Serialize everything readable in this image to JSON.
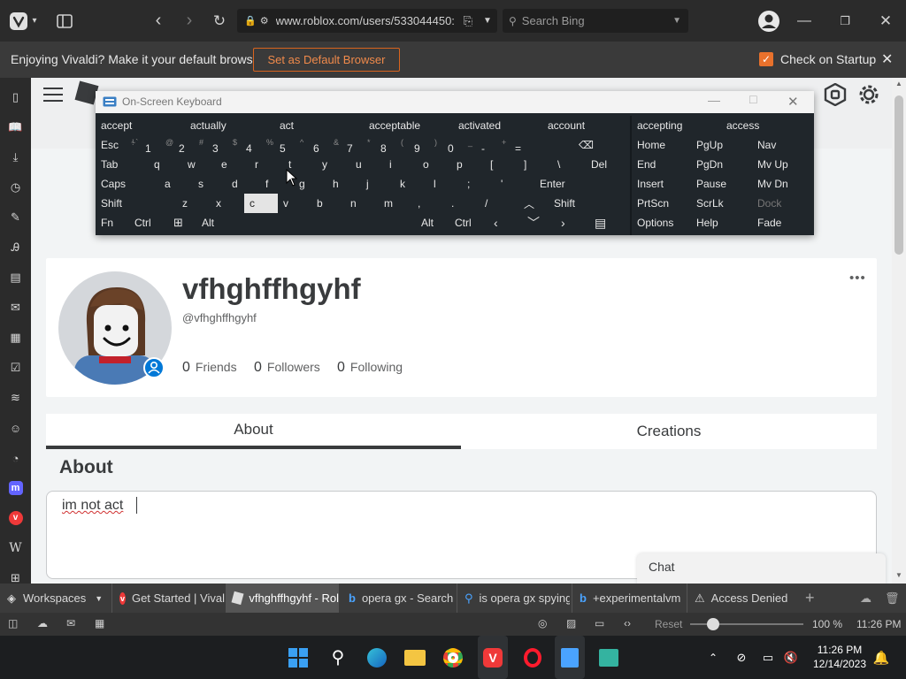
{
  "browser": {
    "url": "www.roblox.com/users/533044450:",
    "search_placeholder": "Search Bing",
    "notification_text": "Enjoying Vivaldi? Make it your default browser.",
    "default_button": "Set as Default Browser",
    "check_startup": "Check on Startup"
  },
  "osk": {
    "title": "On-Screen Keyboard",
    "predictions": [
      "accept",
      "actually",
      "act",
      "acceptable",
      "activated",
      "account",
      "accepting",
      "access"
    ],
    "row1": [
      "Esc",
      "1",
      "2",
      "3",
      "4",
      "5",
      "6",
      "7",
      "8",
      "9",
      "0",
      "-",
      "="
    ],
    "row1_sub": [
      "~`",
      "!",
      "@",
      "#",
      "$",
      "%",
      "^",
      "&",
      "*",
      "(",
      ")",
      "_",
      "+"
    ],
    "row2": [
      "Tab",
      "q",
      "w",
      "e",
      "r",
      "t",
      "y",
      "u",
      "i",
      "o",
      "p",
      "[",
      "]",
      "\\",
      "Del"
    ],
    "row3": [
      "Caps",
      "a",
      "s",
      "d",
      "f",
      "g",
      "h",
      "j",
      "k",
      "l",
      ";",
      "'",
      "Enter"
    ],
    "row4": [
      "Shift",
      "z",
      "x",
      "c",
      "v",
      "b",
      "n",
      "m",
      ",",
      ".",
      "/",
      "Shift"
    ],
    "row5": [
      "Fn",
      "Ctrl",
      "Alt",
      "Alt",
      "Ctrl"
    ],
    "nav_col1": [
      "Home",
      "End",
      "Insert",
      "PrtScn",
      "Options"
    ],
    "nav_col2": [
      "PgUp",
      "PgDn",
      "Pause",
      "ScrLk",
      "Help"
    ],
    "nav_col3": [
      "Nav",
      "Mv Up",
      "Mv Dn",
      "Dock",
      "Fade"
    ]
  },
  "profile": {
    "display_name": "vfhghffhgyhf",
    "username": "@vfhghffhgyhf",
    "friends_count": "0",
    "friends_label": "Friends",
    "followers_count": "0",
    "followers_label": "Followers",
    "following_count": "0",
    "following_label": "Following",
    "tab_about": "About",
    "tab_creations": "Creations",
    "about_heading": "About",
    "about_text": "im not act"
  },
  "chat_label": "Chat",
  "tabs": [
    {
      "label": "Workspaces"
    },
    {
      "label": "Get Started | Vival"
    },
    {
      "label": "vfhghffhgyhf - Rol"
    },
    {
      "label": "opera gx - Search"
    },
    {
      "label": "is opera gx spying"
    },
    {
      "label": "+experimentalvm"
    },
    {
      "label": "Access Denied"
    }
  ],
  "status": {
    "reset": "Reset",
    "zoom": "100 %",
    "time": "11:26 PM"
  },
  "taskbar": {
    "time": "11:26 PM",
    "date": "12/14/2023"
  },
  "colors": {
    "vivaldi_red": "#ef3939",
    "accent_orange": "#e8712c",
    "tab_active": "#2b2b2b",
    "roblox_text": "#393b3d"
  }
}
